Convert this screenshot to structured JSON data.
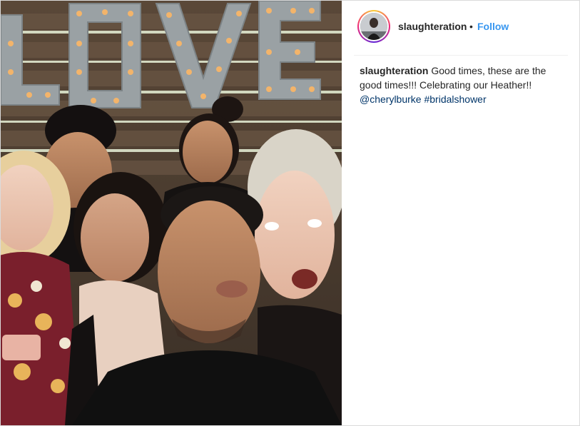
{
  "post": {
    "author": {
      "username": "slaughteration",
      "separator": "•",
      "follow_label": "Follow"
    },
    "caption": {
      "username": "slaughteration",
      "text_line_1": "Good times, these are the good times!!! Celebrating our Heather!!",
      "mention": "@cherylburke",
      "hashtag": "#bridalshower"
    },
    "photo": {
      "sign_text": "LOVE"
    }
  },
  "colors": {
    "follow": "#3897f0",
    "link": "#003569",
    "border": "#dbdbdb",
    "marquee_bulb": "#f3b46a"
  },
  "icons": [
    "avatar-story-ring"
  ]
}
